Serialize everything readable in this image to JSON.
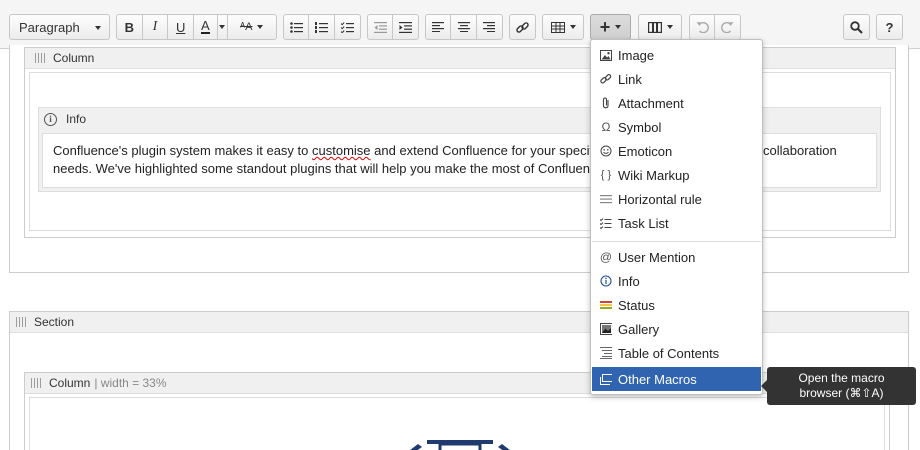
{
  "toolbar": {
    "paragraph_label": "Paragraph",
    "bold": "B",
    "italic": "I",
    "underline": "U",
    "text_color": "A",
    "more_format": "ᴬA",
    "insert_label": "+",
    "help_label": "?"
  },
  "column1": {
    "label": "Column"
  },
  "info": {
    "label": "Info",
    "text_before": "Confluence's plugin system makes it easy to ",
    "text_spell": "customise",
    "text_after": " and extend Confluence for your specifi",
    "text_line1_end": "collaboration",
    "text_line2": "needs. We've highlighted some standout plugins that will help you make the most of Confluenc"
  },
  "section": {
    "label": "Section"
  },
  "column2": {
    "label": "Column",
    "sub": "| width = 33%"
  },
  "insert_menu": {
    "group1": [
      {
        "label": "Image",
        "icon": "image-icon"
      },
      {
        "label": "Link",
        "icon": "link-icon"
      },
      {
        "label": "Attachment",
        "icon": "paperclip-icon"
      },
      {
        "label": "Symbol",
        "icon": "omega-icon"
      },
      {
        "label": "Emoticon",
        "icon": "smiley-icon"
      },
      {
        "label": "Wiki Markup",
        "icon": "braces-icon"
      },
      {
        "label": "Horizontal rule",
        "icon": "horizontal-rule-icon"
      },
      {
        "label": "Task List",
        "icon": "task-list-icon"
      }
    ],
    "group2": [
      {
        "label": "User Mention",
        "icon": "at-icon"
      },
      {
        "label": "Info",
        "icon": "info-icon"
      },
      {
        "label": "Status",
        "icon": "status-icon"
      },
      {
        "label": "Gallery",
        "icon": "gallery-icon"
      },
      {
        "label": "Table of Contents",
        "icon": "toc-icon"
      },
      {
        "label": "Other Macros",
        "icon": "macro-icon"
      }
    ]
  },
  "tooltip": {
    "line1": "Open the macro",
    "line2": "browser (⌘⇧A)"
  },
  "colors": {
    "highlight": "#3064b1",
    "tooltip_bg": "#333333"
  }
}
